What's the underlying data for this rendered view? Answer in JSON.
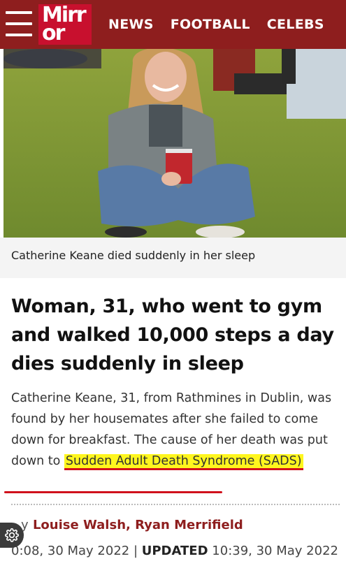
{
  "header": {
    "logo_line1": "Mirr",
    "logo_line2": "or",
    "nav": [
      "NEWS",
      "FOOTBALL",
      "CELEBS"
    ]
  },
  "photo": {
    "description_icon": "photo-woman-sitting-on-grass"
  },
  "caption": "Catherine Keane died suddenly in her sleep",
  "headline": "Woman, 31, who went to gym and walked 10,000 steps a day dies suddenly in sleep",
  "standfirst": {
    "text": "Catherine Keane, 31, from Rathmines in Dublin, was found by her housemates after she failed to come down for breakfast. The cause of her death was put down to ",
    "highlight": "Sudden Adult Death Syndrome (SADS)"
  },
  "byline": {
    "prefix": "y",
    "authors": "Louise Walsh, Ryan Merrifield"
  },
  "dateline": {
    "published": "0:08, 30 May 2022",
    "separator": " | ",
    "updated_label": "UPDATED",
    "updated": " 10:39, 30 May 2022"
  },
  "colors": {
    "header_bg": "#8e1e1e",
    "logo_bg": "#c8102e",
    "highlight": "#fff61e",
    "underline": "#d0111c"
  },
  "settings_icon": "gear-icon"
}
